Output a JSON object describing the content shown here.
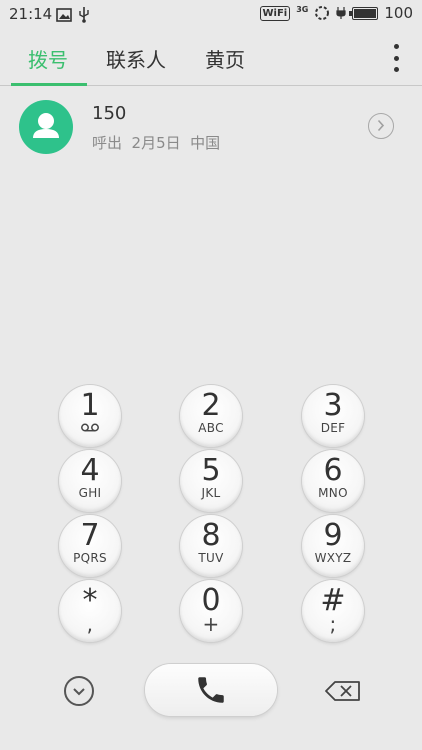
{
  "status_bar": {
    "time": "21:14",
    "wifi_label": "WiFi",
    "network_label": "3G",
    "battery_level": "100"
  },
  "tabs": [
    {
      "label": "拨号",
      "active": true
    },
    {
      "label": "联系人",
      "active": false
    },
    {
      "label": "黄页",
      "active": false
    }
  ],
  "recent_call": {
    "number": "150",
    "meta": "呼出  2月5日  中国"
  },
  "dialpad": [
    {
      "digit": "1",
      "letters": ""
    },
    {
      "digit": "2",
      "letters": "ABC"
    },
    {
      "digit": "3",
      "letters": "DEF"
    },
    {
      "digit": "4",
      "letters": "GHI"
    },
    {
      "digit": "5",
      "letters": "JKL"
    },
    {
      "digit": "6",
      "letters": "MNO"
    },
    {
      "digit": "7",
      "letters": "PQRS"
    },
    {
      "digit": "8",
      "letters": "TUV"
    },
    {
      "digit": "9",
      "letters": "WXYZ"
    },
    {
      "digit": "*",
      "letters": ","
    },
    {
      "digit": "0",
      "letters": "+"
    },
    {
      "digit": "#",
      "letters": ";"
    }
  ],
  "colors": {
    "accent": "#3bbf6f",
    "avatar": "#2ec28b",
    "background": "#e9e9e9"
  }
}
